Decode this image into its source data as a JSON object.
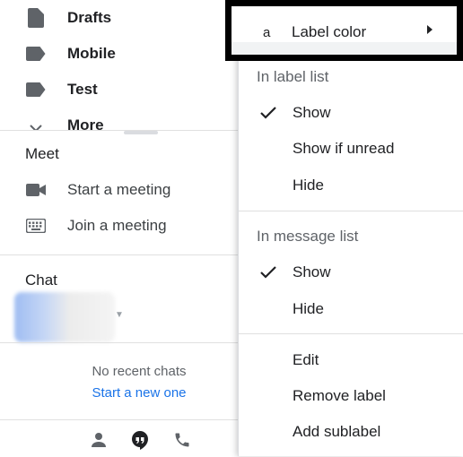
{
  "sidebar": {
    "labels": [
      {
        "label": "Drafts",
        "icon": "draft-icon"
      },
      {
        "label": "Mobile",
        "icon": "label-icon"
      },
      {
        "label": "Test",
        "icon": "label-icon"
      }
    ],
    "more_label": "More",
    "meet": {
      "title": "Meet",
      "items": [
        {
          "label": "Start a meeting",
          "icon": "video-camera-icon"
        },
        {
          "label": "Join a meeting",
          "icon": "keyboard-icon"
        }
      ]
    },
    "chat": {
      "title": "Chat",
      "no_recent": "No recent chats",
      "start_new": "Start a new one"
    },
    "bottom_icons": [
      "person-icon",
      "hangouts-icon",
      "phone-icon"
    ]
  },
  "menu": {
    "label_color": {
      "avatar_letter": "a",
      "label": "Label color"
    },
    "label_list": {
      "heading": "In label list",
      "options": [
        "Show",
        "Show if unread",
        "Hide"
      ],
      "selected_index": 0
    },
    "message_list": {
      "heading": "In message list",
      "options": [
        "Show",
        "Hide"
      ],
      "selected_index": 0
    },
    "actions": [
      "Edit",
      "Remove label",
      "Add sublabel"
    ]
  },
  "colors": {
    "link": "#1a73e8",
    "text": "#202124",
    "muted": "#5f6368",
    "highlight_border": "#000000"
  }
}
